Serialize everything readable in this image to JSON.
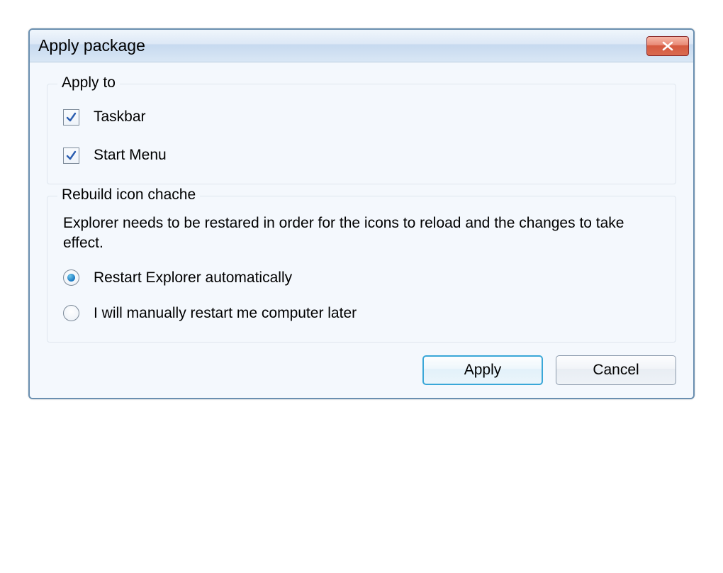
{
  "title": "Apply package",
  "apply_to": {
    "legend": "Apply to",
    "taskbar_label": "Taskbar",
    "taskbar_checked": true,
    "startmenu_label": "Start Menu",
    "startmenu_checked": true
  },
  "rebuild": {
    "legend": "Rebuild icon chache",
    "description": "Explorer needs to be restared in order for the icons to reload and the changes to take effect.",
    "option_auto_label": "Restart Explorer automatically",
    "option_manual_label": "I will manually restart me computer later",
    "selected": "auto"
  },
  "buttons": {
    "apply": "Apply",
    "cancel": "Cancel"
  }
}
